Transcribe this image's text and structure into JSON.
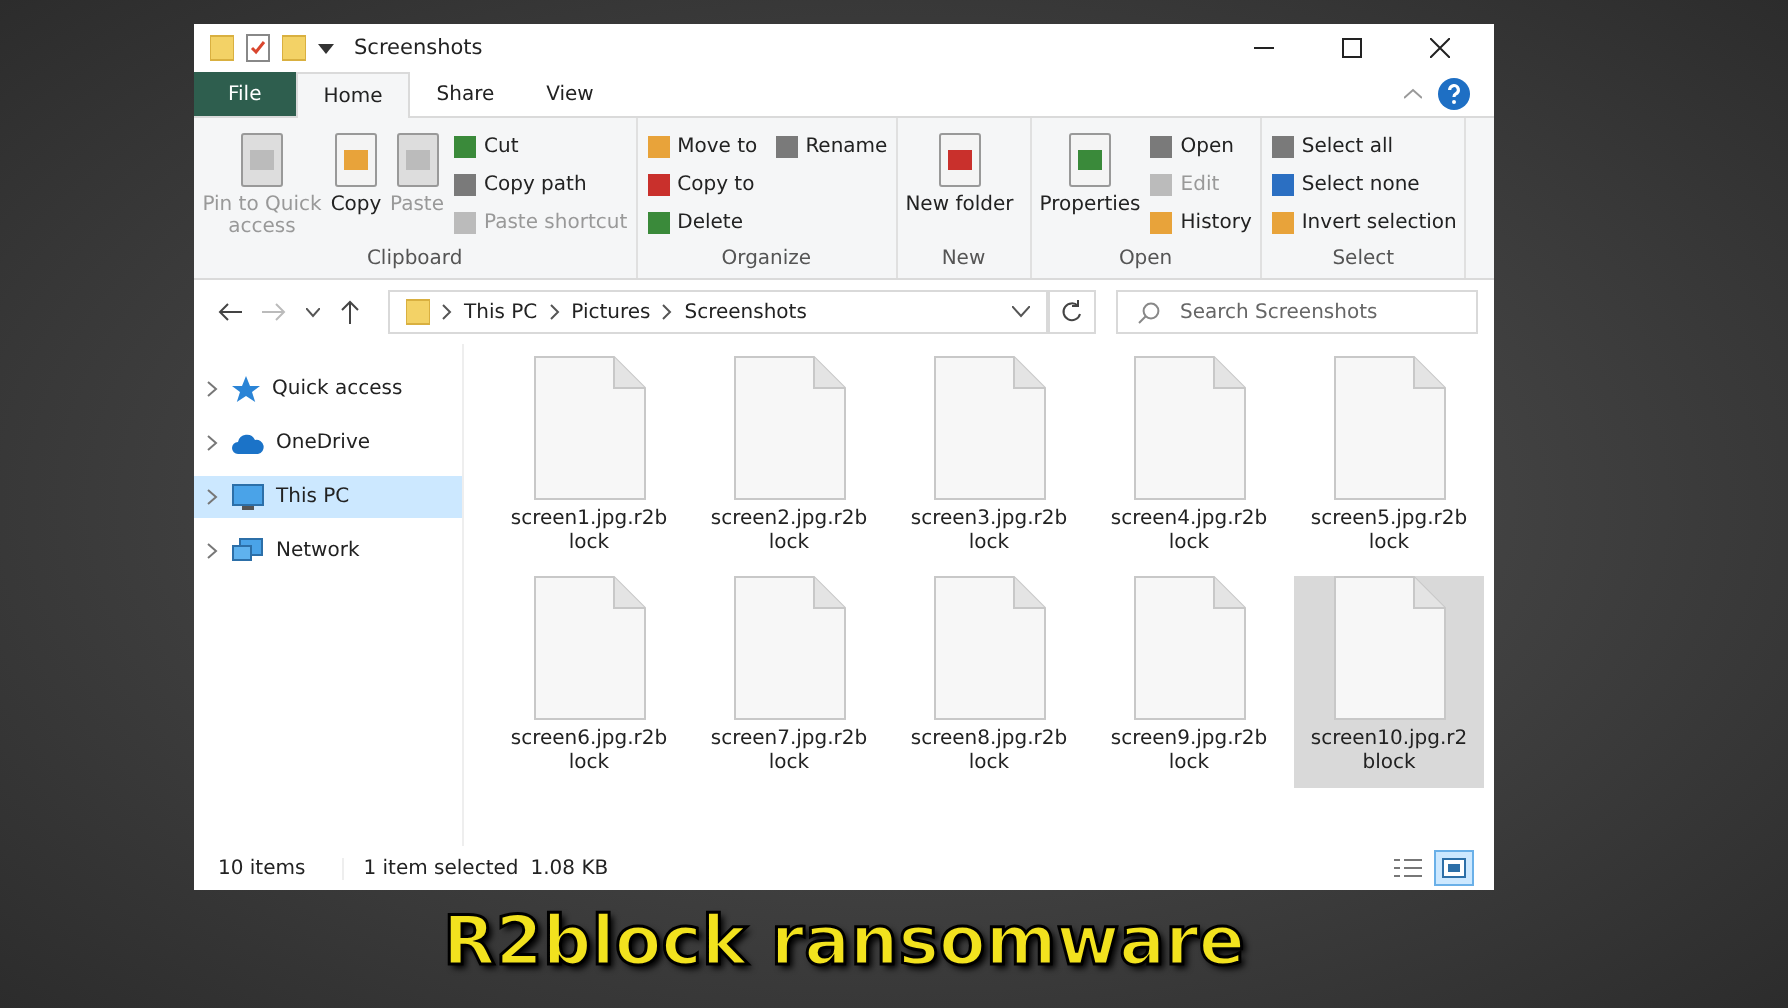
{
  "window": {
    "title": "Screenshots"
  },
  "tabs": [
    {
      "label": "File",
      "kind": "file",
      "selected": false
    },
    {
      "label": "Home",
      "kind": "tab",
      "selected": true
    },
    {
      "label": "Share",
      "kind": "tab",
      "selected": false
    },
    {
      "label": "View",
      "kind": "tab",
      "selected": false
    }
  ],
  "ribbon": [
    {
      "name": "Clipboard",
      "items": [
        {
          "label": "Pin to Quick access",
          "kind": "large",
          "disabled": true
        },
        {
          "label": "Copy",
          "kind": "large",
          "disabled": false
        },
        {
          "label": "Paste",
          "kind": "large",
          "disabled": true
        },
        {
          "label": "Cut",
          "kind": "small",
          "disabled": false
        },
        {
          "label": "Copy path",
          "kind": "small",
          "disabled": false
        },
        {
          "label": "Paste shortcut",
          "kind": "small",
          "disabled": true
        }
      ]
    },
    {
      "name": "Organize",
      "items": [
        {
          "label": "Move to",
          "kind": "small",
          "disabled": false
        },
        {
          "label": "Copy to",
          "kind": "small",
          "disabled": false
        },
        {
          "label": "Delete",
          "kind": "small",
          "disabled": false
        },
        {
          "label": "Rename",
          "kind": "small",
          "disabled": false
        }
      ]
    },
    {
      "name": "New",
      "items": [
        {
          "label": "New folder",
          "kind": "large",
          "disabled": false
        }
      ]
    },
    {
      "name": "Open",
      "items": [
        {
          "label": "Properties",
          "kind": "large",
          "disabled": false
        },
        {
          "label": "Open",
          "kind": "small",
          "disabled": false
        },
        {
          "label": "Edit",
          "kind": "small",
          "disabled": true
        },
        {
          "label": "History",
          "kind": "small",
          "disabled": false
        }
      ]
    },
    {
      "name": "Select",
      "items": [
        {
          "label": "Select all",
          "kind": "small",
          "disabled": false
        },
        {
          "label": "Select none",
          "kind": "small",
          "disabled": false
        },
        {
          "label": "Invert selection",
          "kind": "small",
          "disabled": false
        }
      ]
    }
  ],
  "address": {
    "crumbs": [
      "This PC",
      "Pictures",
      "Screenshots"
    ]
  },
  "search": {
    "placeholder": "Search Screenshots"
  },
  "sidebar": {
    "items": [
      {
        "label": "Quick access",
        "selected": false
      },
      {
        "label": "OneDrive",
        "selected": false
      },
      {
        "label": "This PC",
        "selected": true
      },
      {
        "label": "Network",
        "selected": false
      }
    ]
  },
  "files": [
    {
      "name": "screen1.jpg.r2block",
      "selected": false
    },
    {
      "name": "screen2.jpg.r2block",
      "selected": false
    },
    {
      "name": "screen3.jpg.r2block",
      "selected": false
    },
    {
      "name": "screen4.jpg.r2block",
      "selected": false
    },
    {
      "name": "screen5.jpg.r2block",
      "selected": false
    },
    {
      "name": "screen6.jpg.r2block",
      "selected": false
    },
    {
      "name": "screen7.jpg.r2block",
      "selected": false
    },
    {
      "name": "screen8.jpg.r2block",
      "selected": false
    },
    {
      "name": "screen9.jpg.r2block",
      "selected": false
    },
    {
      "name": "screen10.jpg.r2block",
      "selected": true
    }
  ],
  "status_bar": {
    "count": "10 items",
    "selection": "1 item selected",
    "size": "1.08 KB"
  },
  "caption": "R2block ransomware"
}
